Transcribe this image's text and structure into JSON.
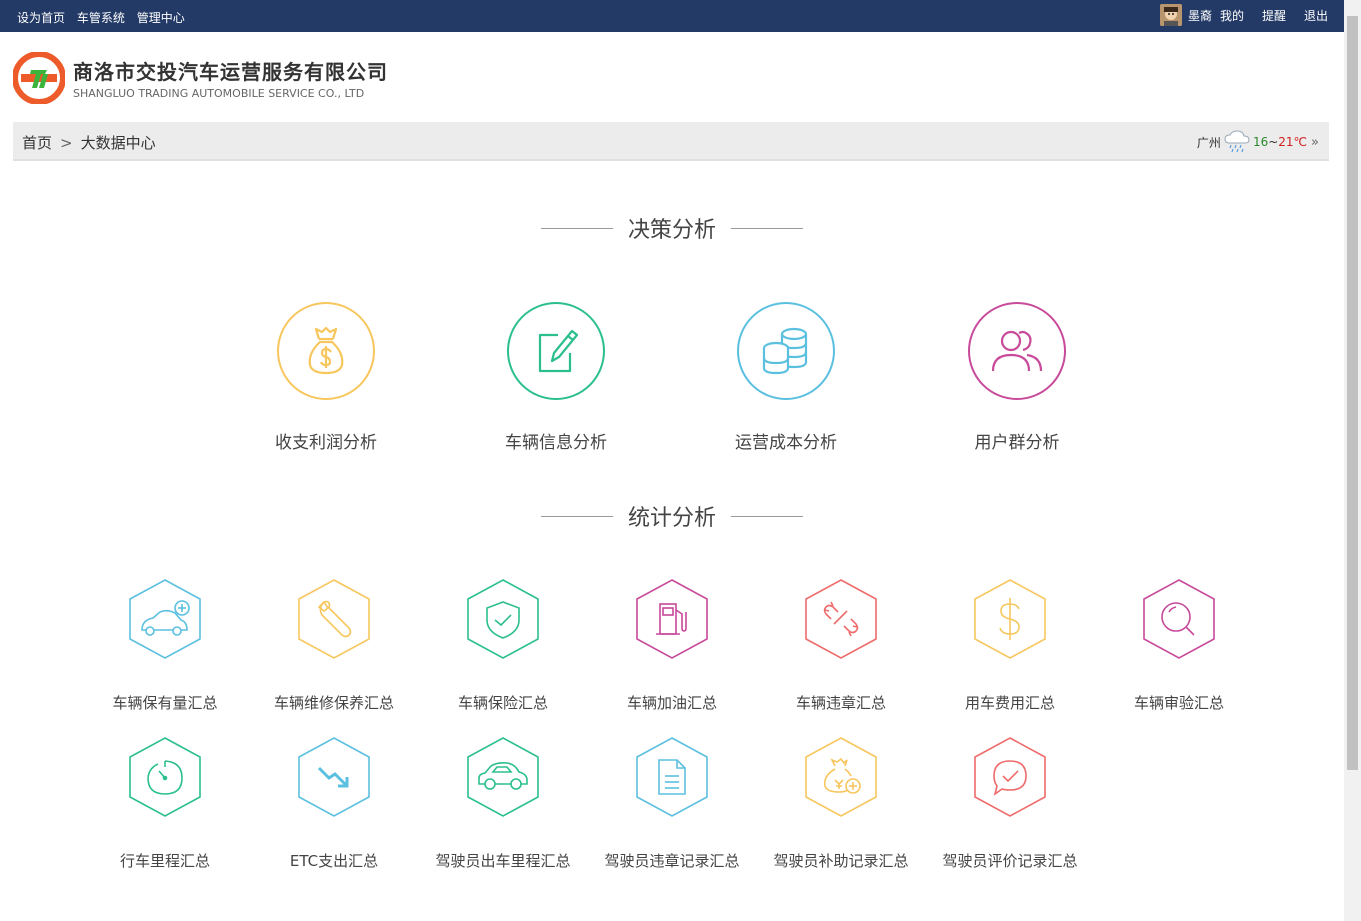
{
  "topbar": {
    "set_home": "设为首页",
    "vehicle_system": "车管系统",
    "admin_center": "管理中心",
    "username": "墨裔",
    "mine": "我的",
    "reminder": "提醒",
    "logout": "退出"
  },
  "logo": {
    "company_cn": "商洛市交投汽车运营服务有限公司",
    "company_en": "SHANGLUO TRADING AUTOMOBILE SERVICE CO., LTD"
  },
  "breadcrumb": {
    "home": "首页",
    "sep": ">",
    "current": "大数据中心"
  },
  "weather": {
    "city": "广州",
    "low": "16",
    "tilde": "~",
    "high": "21℃",
    "icon": "rain-cloud-icon"
  },
  "sections": {
    "decision": "决策分析",
    "statistics": "统计分析"
  },
  "decision_items": [
    {
      "label": "收支利润分析",
      "icon": "money-bag-icon",
      "color": "#f7c65d"
    },
    {
      "label": "车辆信息分析",
      "icon": "edit-icon",
      "color": "#2bbf8e"
    },
    {
      "label": "运营成本分析",
      "icon": "coins-icon",
      "color": "#5bc0e0"
    },
    {
      "label": "用户群分析",
      "icon": "users-icon",
      "color": "#c84a9a"
    }
  ],
  "stat_items": [
    {
      "label": "车辆保有量汇总",
      "icon": "car-add-icon",
      "color": "#5bc0e0"
    },
    {
      "label": "车辆维修保养汇总",
      "icon": "wrench-icon",
      "color": "#f7c65d"
    },
    {
      "label": "车辆保险汇总",
      "icon": "shield-check-icon",
      "color": "#2bbf8e"
    },
    {
      "label": "车辆加油汇总",
      "icon": "fuel-pump-icon",
      "color": "#c84a9a"
    },
    {
      "label": "车辆违章汇总",
      "icon": "broken-link-icon",
      "color": "#ef6b6b"
    },
    {
      "label": "用车费用汇总",
      "icon": "dollar-icon",
      "color": "#f7c65d"
    },
    {
      "label": "车辆审验汇总",
      "icon": "magnifier-icon",
      "color": "#c84a9a"
    },
    {
      "label": "行车里程汇总",
      "icon": "timer-icon",
      "color": "#2bbf8e"
    },
    {
      "label": "ETC支出汇总",
      "icon": "trend-down-icon",
      "color": "#5bc0e0"
    },
    {
      "label": "驾驶员出车里程汇总",
      "icon": "car-icon",
      "color": "#2bbf8e"
    },
    {
      "label": "驾驶员违章记录汇总",
      "icon": "document-icon",
      "color": "#5bc0e0"
    },
    {
      "label": "驾驶员补助记录汇总",
      "icon": "money-plus-icon",
      "color": "#f7c65d"
    },
    {
      "label": "驾驶员评价记录汇总",
      "icon": "chat-check-icon",
      "color": "#ef6b6b"
    }
  ]
}
